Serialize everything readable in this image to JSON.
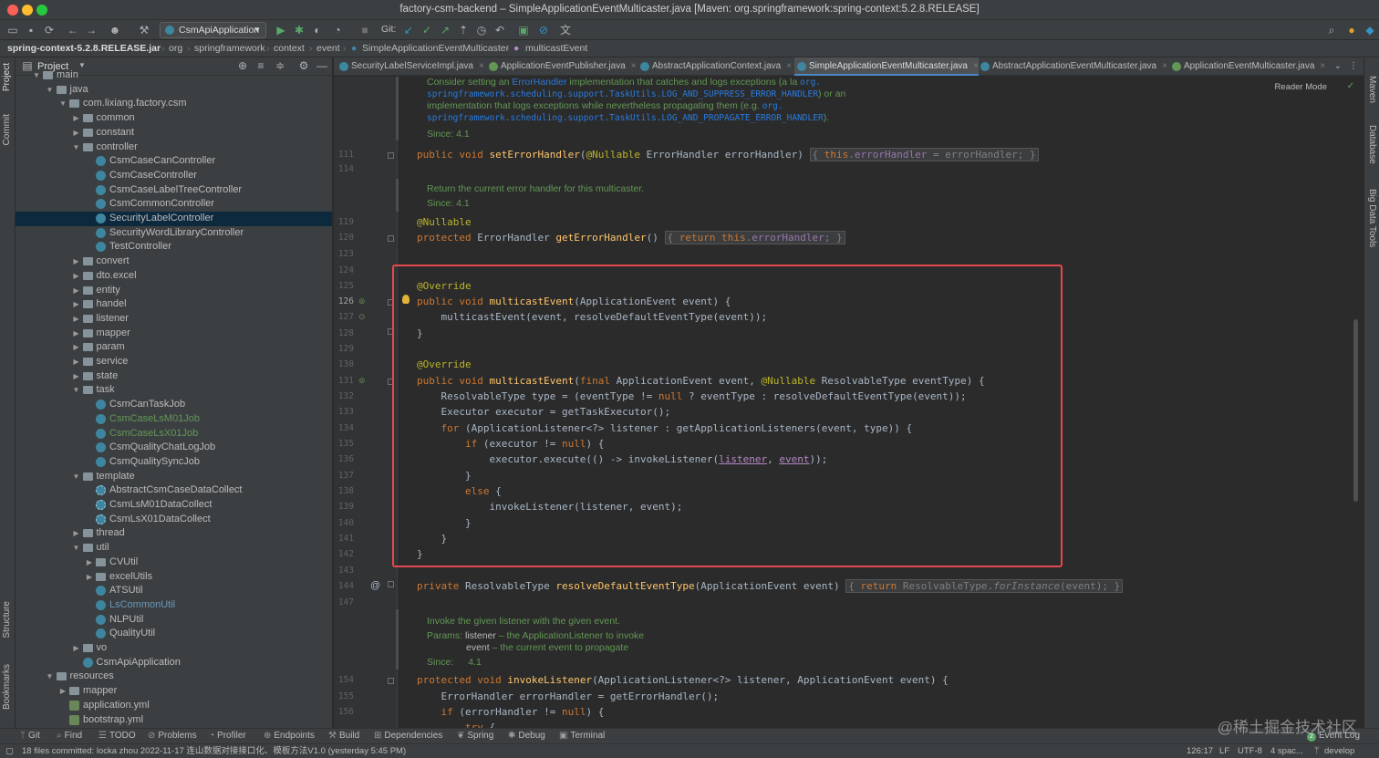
{
  "window": {
    "title": "factory-csm-backend – SimpleApplicationEventMulticaster.java [Maven: org.springframework:spring-context:5.2.8.RELEASE]"
  },
  "toolbar": {
    "run_config": "CsmApiApplication",
    "git_label": "Git:"
  },
  "breadcrumb": [
    "spring-context-5.2.8.RELEASE.jar",
    "org",
    "springframework",
    "context",
    "event",
    "SimpleApplicationEventMulticaster",
    "multicastEvent"
  ],
  "left_strip": {
    "project": "Project",
    "commit": "Commit",
    "structure": "Structure",
    "bookmarks": "Bookmarks"
  },
  "right_strip": {
    "maven": "Maven",
    "database": "Database",
    "bigdata": "Big Data Tools"
  },
  "project_panel": {
    "title": "Project",
    "tree": [
      {
        "label": "main",
        "depth": 4,
        "kind": "folder",
        "open": true
      },
      {
        "label": "java",
        "depth": 5,
        "kind": "folder",
        "open": true
      },
      {
        "label": "com.lixiang.factory.csm",
        "depth": 6,
        "kind": "folder",
        "open": true
      },
      {
        "label": "common",
        "depth": 7,
        "kind": "folder",
        "open": false
      },
      {
        "label": "constant",
        "depth": 7,
        "kind": "folder",
        "open": false
      },
      {
        "label": "controller",
        "depth": 7,
        "kind": "folder",
        "open": true
      },
      {
        "label": "CsmCaseCanController",
        "depth": 8,
        "kind": "class"
      },
      {
        "label": "CsmCaseController",
        "depth": 8,
        "kind": "class"
      },
      {
        "label": "CsmCaseLabelTreeController",
        "depth": 8,
        "kind": "class"
      },
      {
        "label": "CsmCommonController",
        "depth": 8,
        "kind": "class"
      },
      {
        "label": "SecurityLabelController",
        "depth": 8,
        "kind": "class",
        "selected": true
      },
      {
        "label": "SecurityWordLibraryController",
        "depth": 8,
        "kind": "class"
      },
      {
        "label": "TestController",
        "depth": 8,
        "kind": "class"
      },
      {
        "label": "convert",
        "depth": 7,
        "kind": "folder",
        "open": false
      },
      {
        "label": "dto.excel",
        "depth": 7,
        "kind": "folder",
        "open": false
      },
      {
        "label": "entity",
        "depth": 7,
        "kind": "folder",
        "open": false
      },
      {
        "label": "handel",
        "depth": 7,
        "kind": "folder",
        "open": false
      },
      {
        "label": "listener",
        "depth": 7,
        "kind": "folder",
        "open": false
      },
      {
        "label": "mapper",
        "depth": 7,
        "kind": "folder",
        "open": false
      },
      {
        "label": "param",
        "depth": 7,
        "kind": "folder",
        "open": false
      },
      {
        "label": "service",
        "depth": 7,
        "kind": "folder",
        "open": false
      },
      {
        "label": "state",
        "depth": 7,
        "kind": "folder",
        "open": false
      },
      {
        "label": "task",
        "depth": 7,
        "kind": "folder",
        "open": true
      },
      {
        "label": "CsmCanTaskJob",
        "depth": 8,
        "kind": "class"
      },
      {
        "label": "CsmCaseLsM01Job",
        "depth": 8,
        "kind": "class",
        "color": "green"
      },
      {
        "label": "CsmCaseLsX01Job",
        "depth": 8,
        "kind": "class",
        "color": "green"
      },
      {
        "label": "CsmQualityChatLogJob",
        "depth": 8,
        "kind": "class"
      },
      {
        "label": "CsmQualitySyncJob",
        "depth": 8,
        "kind": "class"
      },
      {
        "label": "template",
        "depth": 7,
        "kind": "folder",
        "open": true
      },
      {
        "label": "AbstractCsmCaseDataCollect",
        "depth": 8,
        "kind": "abstract"
      },
      {
        "label": "CsmLsM01DataCollect",
        "depth": 8,
        "kind": "abstract"
      },
      {
        "label": "CsmLsX01DataCollect",
        "depth": 8,
        "kind": "abstract"
      },
      {
        "label": "thread",
        "depth": 7,
        "kind": "folder",
        "open": false
      },
      {
        "label": "util",
        "depth": 7,
        "kind": "folder",
        "open": true
      },
      {
        "label": "CVUtil",
        "depth": 8,
        "kind": "folder",
        "open": false
      },
      {
        "label": "excelUtils",
        "depth": 8,
        "kind": "folder",
        "open": false
      },
      {
        "label": "ATSUtil",
        "depth": 8,
        "kind": "class"
      },
      {
        "label": "LsCommonUtil",
        "depth": 8,
        "kind": "class",
        "color": "blue"
      },
      {
        "label": "NLPUtil",
        "depth": 8,
        "kind": "class"
      },
      {
        "label": "QualityUtil",
        "depth": 8,
        "kind": "class"
      },
      {
        "label": "vo",
        "depth": 7,
        "kind": "folder",
        "open": false
      },
      {
        "label": "CsmApiApplication",
        "depth": 7,
        "kind": "class"
      },
      {
        "label": "resources",
        "depth": 5,
        "kind": "folder",
        "open": true
      },
      {
        "label": "mapper",
        "depth": 6,
        "kind": "folder",
        "open": false
      },
      {
        "label": "application.yml",
        "depth": 6,
        "kind": "file"
      },
      {
        "label": "bootstrap.yml",
        "depth": 6,
        "kind": "file"
      }
    ]
  },
  "editor_tabs": [
    {
      "label": "SecurityLabelServiceImpl.java",
      "iface": false,
      "active": false
    },
    {
      "label": "ApplicationEventPublisher.java",
      "iface": true,
      "active": false
    },
    {
      "label": "AbstractApplicationContext.java",
      "iface": false,
      "active": false
    },
    {
      "label": "SimpleApplicationEventMulticaster.java",
      "iface": false,
      "active": true
    },
    {
      "label": "AbstractApplicationEventMulticaster.java",
      "iface": false,
      "active": false
    },
    {
      "label": "ApplicationEventMulticaster.java",
      "iface": true,
      "active": false
    }
  ],
  "editor": {
    "reader_mode": "Reader Mode",
    "line_numbers": [
      "111",
      "114",
      "119",
      "120",
      "123",
      "124",
      "125",
      "126",
      "127",
      "128",
      "129",
      "130",
      "131",
      "132",
      "133",
      "134",
      "135",
      "136",
      "137",
      "138",
      "139",
      "140",
      "141",
      "142",
      "143",
      "144",
      "147",
      "154",
      "155",
      "156"
    ],
    "doc1": {
      "line1_pre": "Consider setting an ",
      "line1_link": "ErrorHandler",
      "line1_post": " implementation that catches and logs exceptions (a la ",
      "line1_link2": "org.",
      "line2_link": "springframework.scheduling.support.TaskUtils.LOG_AND_SUPPRESS_ERROR_HANDLER",
      "line2_post": ") or an",
      "line3_pre": "implementation that logs exceptions while nevertheless propagating them (e.g. ",
      "line3_link": "org.",
      "line4_link": "springframework.scheduling.support.TaskUtils.LOG_AND_PROPAGATE_ERROR_HANDLER",
      "line4_post": ").",
      "since": "Since: 4.1"
    },
    "doc2": {
      "line1": "Return the current error handler for this multicaster.",
      "since": "Since: 4.1"
    },
    "doc3": {
      "line1": "Invoke the given listener with the given event.",
      "params_label": "Params:",
      "p1_name": "listener",
      "p1_desc": " – the ApplicationListener to invoke",
      "p2_name": "event",
      "p2_desc": " – the current event to propagate",
      "since_label": "Since:",
      "since_val": "4.1"
    }
  },
  "bottom_tools": [
    "Git",
    "Find",
    "TODO",
    "Problems",
    "Profiler",
    "Endpoints",
    "Build",
    "Dependencies",
    "Spring",
    "Debug",
    "Terminal"
  ],
  "event_log": {
    "count": "2",
    "label": "Event Log"
  },
  "status": {
    "message": "18 files committed: locka zhou 2022-11-17 连山数据对接接口化、模板方法V1.0 (yesterday 5:45 PM)",
    "position": "126:17",
    "line_sep": "LF",
    "encoding": "UTF-8",
    "indent": "4 spac...",
    "branch": "develop"
  },
  "watermark": "@稀土掘金技术社区"
}
